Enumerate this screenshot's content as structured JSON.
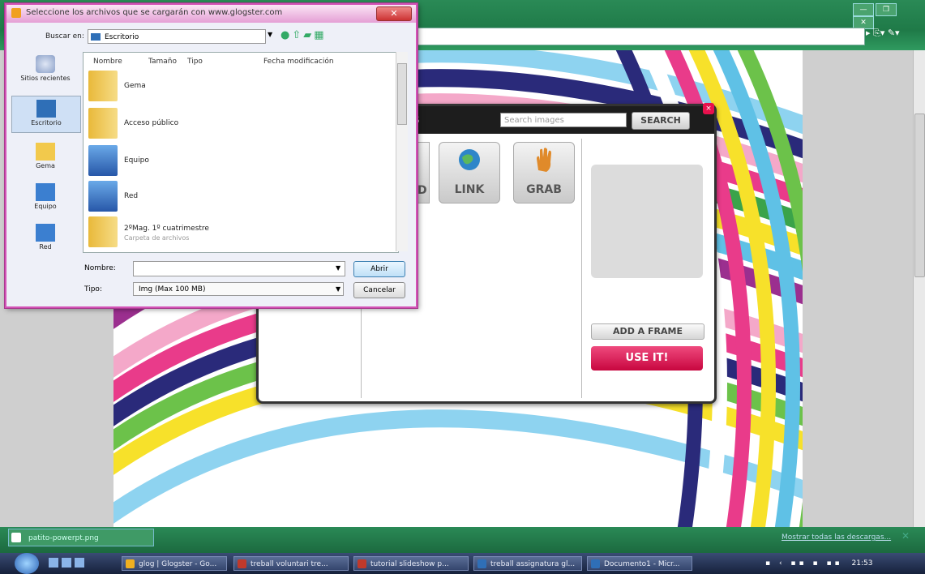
{
  "browser": {
    "tab_title": "glog | Glogster - Go...",
    "address_actions": "▸  ⎘▾  ✎▾",
    "window_controls": [
      "—",
      "❐",
      "✕"
    ]
  },
  "glogster_dialog": {
    "tab_label": "S",
    "search_placeholder": "Search images",
    "search_button": "SEARCH",
    "upload_partial_label": "D",
    "link_label": "LINK",
    "grab_label": "GRAB",
    "add_frame_button": "ADD A FRAME",
    "use_it_button": "USE IT!",
    "close": "×"
  },
  "file_dialog": {
    "title": "Seleccione los archivos que se cargarán con www.glogster.com",
    "close": "✕",
    "look_in_label": "Buscar en:",
    "look_in_value": "Escritorio",
    "places": [
      {
        "label": "Sitios recientes",
        "icon": "recent-places-icon"
      },
      {
        "label": "Escritorio",
        "icon": "desktop-icon"
      },
      {
        "label": "Gema",
        "icon": "user-folder-icon"
      },
      {
        "label": "Equipo",
        "icon": "computer-icon"
      },
      {
        "label": "Red",
        "icon": "network-icon"
      }
    ],
    "columns": [
      "Nombre",
      "Tamaño",
      "Tipo",
      "Fecha modificación"
    ],
    "items": [
      {
        "name": "Gema",
        "sub": "",
        "icon": "user-folder-icon"
      },
      {
        "name": "Acceso público",
        "sub": "",
        "icon": "folder-icon"
      },
      {
        "name": "Equipo",
        "sub": "",
        "icon": "computer-icon"
      },
      {
        "name": "Red",
        "sub": "",
        "icon": "network-icon"
      },
      {
        "name": "2ºMag. 1º cuatrimestre",
        "sub": "Carpeta de archivos",
        "icon": "folder-icon"
      }
    ],
    "name_label": "Nombre:",
    "name_value": "",
    "type_label": "Tipo:",
    "type_value": "Img (Max 100 MB)",
    "open_button": "Abrir",
    "cancel_button": "Cancelar"
  },
  "downloads": {
    "item": "patito-powerpt.png",
    "show_all": "Mostrar todas las descargas..."
  },
  "taskbar": {
    "items": [
      {
        "label": "glog | Glogster - Go...",
        "color": "#f0b020"
      },
      {
        "label": "treball voluntari tre...",
        "color": "#c0392b"
      },
      {
        "label": "tutorial slideshow p...",
        "color": "#c0392b"
      },
      {
        "label": "treball assignatura gl...",
        "color": "#2f6fb7"
      },
      {
        "label": "Documento1 - Micr...",
        "color": "#2f6fb7"
      }
    ],
    "clock": "21:53"
  }
}
